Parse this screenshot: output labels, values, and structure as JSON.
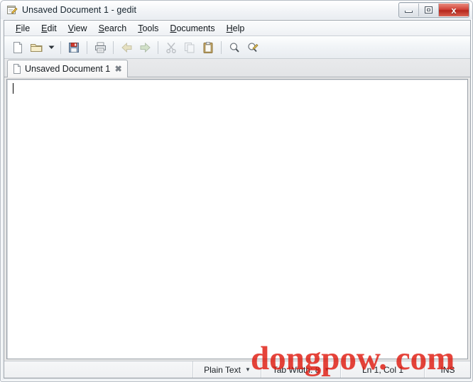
{
  "window": {
    "title": "Unsaved Document 1 - gedit",
    "icon": "gedit-pencil-notepad-icon",
    "caption_buttons": {
      "minimize": "minimize-icon",
      "maximize": "maximize-icon",
      "close": "x"
    }
  },
  "menubar": {
    "items": [
      {
        "label": "File",
        "mnemonic": "F"
      },
      {
        "label": "Edit",
        "mnemonic": "E"
      },
      {
        "label": "View",
        "mnemonic": "V"
      },
      {
        "label": "Search",
        "mnemonic": "S"
      },
      {
        "label": "Tools",
        "mnemonic": "T"
      },
      {
        "label": "Documents",
        "mnemonic": "D"
      },
      {
        "label": "Help",
        "mnemonic": "H"
      }
    ]
  },
  "toolbar": {
    "buttons": [
      {
        "name": "new-document-button",
        "icon": "new-document-icon",
        "enabled": true
      },
      {
        "name": "open-button",
        "icon": "open-folder-icon",
        "enabled": true
      },
      {
        "name": "open-dropdown-button",
        "icon": "chevron-down-icon",
        "enabled": true
      },
      {
        "name": "save-button",
        "icon": "save-floppy-icon",
        "enabled": true
      },
      {
        "name": "print-button",
        "icon": "printer-icon",
        "enabled": true
      },
      {
        "name": "undo-button",
        "icon": "undo-arrow-icon",
        "enabled": false
      },
      {
        "name": "redo-button",
        "icon": "redo-arrow-icon",
        "enabled": false
      },
      {
        "name": "cut-button",
        "icon": "scissors-icon",
        "enabled": false
      },
      {
        "name": "copy-button",
        "icon": "copy-pages-icon",
        "enabled": false
      },
      {
        "name": "paste-button",
        "icon": "clipboard-icon",
        "enabled": true
      },
      {
        "name": "find-button",
        "icon": "magnifier-icon",
        "enabled": true
      },
      {
        "name": "replace-button",
        "icon": "find-replace-icon",
        "enabled": true
      }
    ]
  },
  "tabs": [
    {
      "label": "Unsaved Document 1",
      "icon": "document-icon",
      "close_label": "✖",
      "active": true
    }
  ],
  "editor": {
    "content": "",
    "caret_visible": true
  },
  "statusbar": {
    "language": "Plain Text",
    "language_arrow": "▼",
    "tab_width": "Tab Width: 8",
    "tab_width_arrow": "▼",
    "position": "Ln 1, Col 1",
    "insert_mode": "INS"
  },
  "watermark": {
    "text": "dongpow. com",
    "color": "#e01b10"
  }
}
